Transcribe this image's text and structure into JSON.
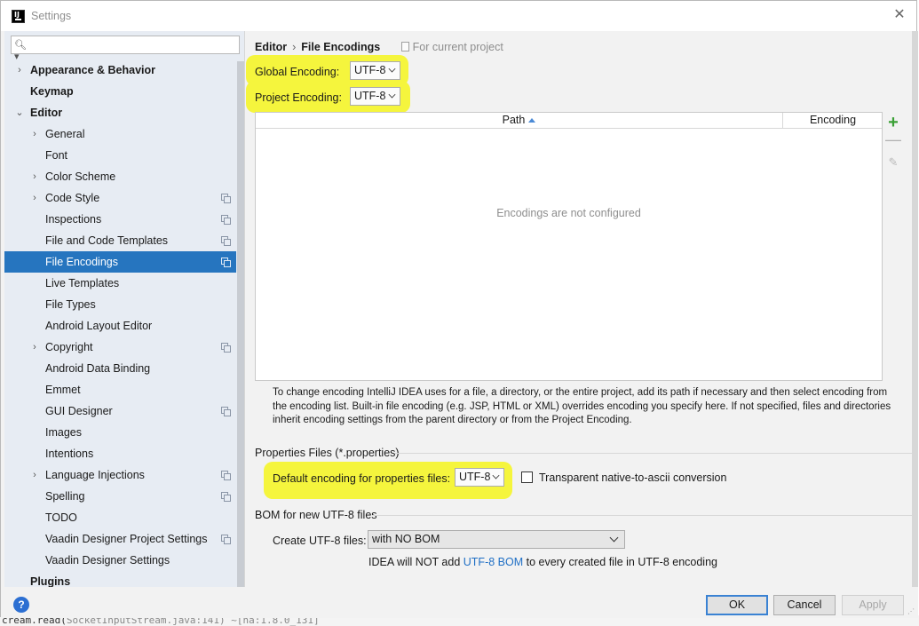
{
  "window": {
    "title": "Settings"
  },
  "search": {
    "placeholder": ""
  },
  "sidebar": {
    "items": [
      {
        "label": "Appearance & Behavior",
        "bold": true,
        "arrow": "›"
      },
      {
        "label": "Keymap",
        "bold": true
      },
      {
        "label": "Editor",
        "bold": true,
        "arrow": "⌄"
      },
      {
        "label": "General",
        "arrow": "›"
      },
      {
        "label": "Font"
      },
      {
        "label": "Color Scheme",
        "arrow": "›"
      },
      {
        "label": "Code Style",
        "arrow": "›",
        "copy": true
      },
      {
        "label": "Inspections",
        "copy": true
      },
      {
        "label": "File and Code Templates",
        "copy": true
      },
      {
        "label": "File Encodings",
        "copy": true,
        "selected": true
      },
      {
        "label": "Live Templates"
      },
      {
        "label": "File Types"
      },
      {
        "label": "Android Layout Editor"
      },
      {
        "label": "Copyright",
        "arrow": "›",
        "copy": true
      },
      {
        "label": "Android Data Binding"
      },
      {
        "label": "Emmet"
      },
      {
        "label": "GUI Designer",
        "copy": true
      },
      {
        "label": "Images"
      },
      {
        "label": "Intentions"
      },
      {
        "label": "Language Injections",
        "arrow": "›",
        "copy": true
      },
      {
        "label": "Spelling",
        "copy": true
      },
      {
        "label": "TODO"
      },
      {
        "label": "Vaadin Designer Project Settings",
        "copy": true
      },
      {
        "label": "Vaadin Designer Settings"
      },
      {
        "label": "Plugins",
        "bold": true
      }
    ]
  },
  "breadcrumb": {
    "parent": "Editor",
    "separator": "›",
    "current": "File Encodings",
    "scope": "For current project"
  },
  "global_encoding": {
    "label": "Global Encoding:",
    "value": "UTF-8"
  },
  "project_encoding": {
    "label": "Project Encoding:",
    "value": "UTF-8"
  },
  "table": {
    "columns": [
      "Path",
      "Encoding"
    ],
    "empty_text": "Encodings are not configured"
  },
  "toolbar": {
    "add": "+",
    "remove": "—",
    "edit": "✎"
  },
  "help_text": "To change encoding IntelliJ IDEA uses for a file, a directory, or the entire project, add its path if necessary and then select encoding from the encoding list. Built-in file encoding (e.g. JSP, HTML or XML) overrides encoding you specify here. If not specified, files and directories inherit encoding settings from the parent directory or from the Project Encoding.",
  "properties": {
    "section_title": "Properties Files (*.properties)",
    "default_label": "Default encoding for properties files:",
    "default_value": "UTF-8",
    "transparent_label": "Transparent native-to-ascii conversion",
    "transparent_checked": false
  },
  "bom": {
    "section_title": "BOM for new UTF-8 files",
    "create_label": "Create UTF-8 files:",
    "create_value": "with NO BOM",
    "note_prefix": "IDEA will NOT add ",
    "note_link": "UTF-8 BOM",
    "note_suffix": " to every created file in UTF-8 encoding"
  },
  "buttons": {
    "ok": "OK",
    "cancel": "Cancel",
    "apply": "Apply",
    "help": "?"
  },
  "background_editor": {
    "text_prefix": "cream.read(",
    "text_muted": "SocketInputStream.java:141) ~[na:1.8.0_131]"
  },
  "colors": {
    "highlight": "#f5f53d",
    "selection": "#2675bf",
    "link": "#1f6fc5",
    "add_icon": "#3aa035"
  }
}
